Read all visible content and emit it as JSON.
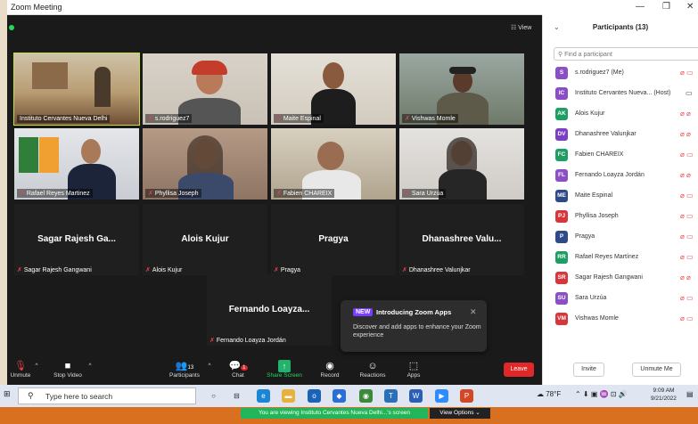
{
  "window": {
    "title": "Zoom Meeting",
    "view_label": "View"
  },
  "tiles": [
    {
      "name": "Instituto Cervantes Nueva Delhi"
    },
    {
      "name": "s.rodriguez7"
    },
    {
      "name": "Maite Espinal"
    },
    {
      "name": "Vishwas Momle"
    },
    {
      "name": "Rafael Reyes Martinez"
    },
    {
      "name": "Phyllisa Joseph"
    },
    {
      "name": "Fabien CHAREIX"
    },
    {
      "name": "Sara Urzúa"
    }
  ],
  "name_tiles": [
    {
      "display": "Sagar Rajesh Ga...",
      "name": "Sagar Rajesh Gangwani"
    },
    {
      "display": "Alois Kujur",
      "name": "Alois Kujur"
    },
    {
      "display": "Pragya",
      "name": "Pragya"
    },
    {
      "display": "Dhanashree Valu...",
      "name": "Dhanashree Valunjkar"
    },
    {
      "display": "Fernando Loayza...",
      "name": "Fernando Loayza Jordán"
    }
  ],
  "popup": {
    "badge": "NEW",
    "title": "Introducing Zoom Apps",
    "body": "Discover and add apps to enhance your Zoom experience",
    "close": "✕"
  },
  "toolbar": {
    "unmute": "Unmute",
    "stop_video": "Stop Video",
    "participants": "Participants",
    "participants_count": "13",
    "chat": "Chat",
    "chat_badge": "1",
    "share_screen": "Share Screen",
    "record": "Record",
    "reactions": "Reactions",
    "apps": "Apps",
    "leave": "Leave"
  },
  "panel": {
    "title": "Participants (13)",
    "search_placeholder": "Find a participant",
    "participants": [
      {
        "initials": "S",
        "name": "s.rodriguez7 (Me)",
        "color": "#8a4fc6"
      },
      {
        "initials": "IC",
        "name": "Instituto Cervantes Nueva... (Host)",
        "color": "#8a4fc6"
      },
      {
        "initials": "AK",
        "name": "Alois Kujur",
        "color": "#1d9e62"
      },
      {
        "initials": "DV",
        "name": "Dhanashree Valunjkar",
        "color": "#7b3fc4"
      },
      {
        "initials": "FC",
        "name": "Fabien CHAREIX",
        "color": "#1d9e62"
      },
      {
        "initials": "FL",
        "name": "Fernando Loayza Jordán",
        "color": "#8a4fc6"
      },
      {
        "initials": "ME",
        "name": "Maite Espinal",
        "color": "#2d4a8a"
      },
      {
        "initials": "PJ",
        "name": "Phyllisa Joseph",
        "color": "#d7363a"
      },
      {
        "initials": "P",
        "name": "Pragya",
        "color": "#2d4a8a"
      },
      {
        "initials": "RR",
        "name": "Rafael Reyes Martínez",
        "color": "#1d9e62"
      },
      {
        "initials": "SR",
        "name": "Sagar Rajesh Gangwani",
        "color": "#d7363a"
      },
      {
        "initials": "SU",
        "name": "Sara Urzúa",
        "color": "#8a4fc6"
      },
      {
        "initials": "VM",
        "name": "Vishwas Momle",
        "color": "#d7363a"
      }
    ],
    "invite": "Invite",
    "unmute_me": "Unmute Me"
  },
  "taskbar": {
    "search_placeholder": "Type here to search",
    "weather": "78°F",
    "time": "9:09 AM",
    "date": "9/21/2022"
  },
  "share_bar": {
    "message": "You are viewing Instituto Cervantes Nueva Delhi...'s screen",
    "view_options": "View Options ⌄"
  }
}
